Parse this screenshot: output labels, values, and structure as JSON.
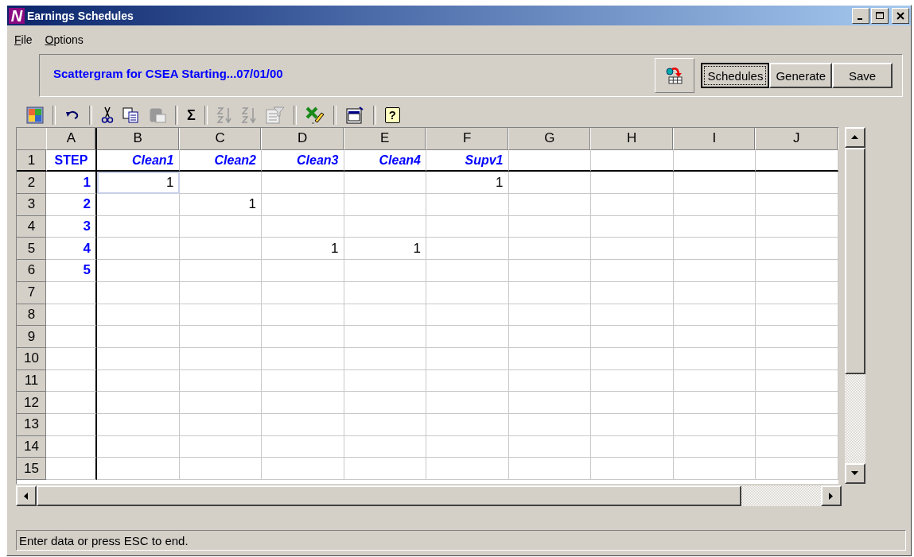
{
  "window": {
    "title": "Earnings Schedules",
    "logo": "N"
  },
  "menu": [
    {
      "label": "File"
    },
    {
      "label": "Options"
    }
  ],
  "header": {
    "title": "Scattergram for CSEA Starting...07/01/00",
    "buttons": [
      {
        "label": "Schedules",
        "selected": true
      },
      {
        "label": "Generate",
        "selected": false
      },
      {
        "label": "Save",
        "selected": false
      }
    ]
  },
  "toolbar": [
    {
      "kind": "puzzle",
      "disabled": false
    },
    {
      "kind": "separator"
    },
    {
      "kind": "undo",
      "disabled": false
    },
    {
      "kind": "separator"
    },
    {
      "kind": "cut",
      "disabled": false
    },
    {
      "kind": "copy",
      "disabled": false
    },
    {
      "kind": "paste",
      "disabled": true
    },
    {
      "kind": "separator"
    },
    {
      "kind": "sum",
      "label": "Σ",
      "disabled": false
    },
    {
      "kind": "separator"
    },
    {
      "kind": "sort-asc",
      "disabled": true
    },
    {
      "kind": "sort-desc",
      "disabled": true
    },
    {
      "kind": "filter",
      "disabled": true
    },
    {
      "kind": "separator"
    },
    {
      "kind": "export",
      "disabled": false
    },
    {
      "kind": "separator"
    },
    {
      "kind": "clipboard",
      "disabled": false
    },
    {
      "kind": "separator"
    },
    {
      "kind": "help",
      "label": "?",
      "disabled": false
    }
  ],
  "grid": {
    "columns": [
      "A",
      "B",
      "C",
      "D",
      "E",
      "F",
      "G",
      "H",
      "I",
      "J"
    ],
    "rows": [
      {
        "number": "1",
        "cells": [
          {
            "text": "STEP",
            "selected": false
          },
          {
            "text": "Clean1",
            "selected": false
          },
          {
            "text": "Clean2",
            "selected": false
          },
          {
            "text": "Clean3",
            "selected": false
          },
          {
            "text": "Clean4",
            "selected": false
          },
          {
            "text": "Supv1",
            "selected": false
          },
          null,
          null,
          null,
          null
        ]
      },
      {
        "number": "2",
        "cells": [
          {
            "text": "1",
            "selected": false
          },
          {
            "text": "1",
            "selected": true
          },
          null,
          null,
          null,
          {
            "text": "1",
            "selected": false
          },
          null,
          null,
          null,
          null
        ]
      },
      {
        "number": "3",
        "cells": [
          {
            "text": "2",
            "selected": false
          },
          null,
          {
            "text": "1",
            "selected": false
          },
          null,
          null,
          null,
          null,
          null,
          null,
          null
        ]
      },
      {
        "number": "4",
        "cells": [
          {
            "text": "3",
            "selected": false
          },
          null,
          null,
          null,
          null,
          null,
          null,
          null,
          null,
          null
        ]
      },
      {
        "number": "5",
        "cells": [
          {
            "text": "4",
            "selected": false
          },
          null,
          null,
          {
            "text": "1",
            "selected": false
          },
          {
            "text": "1",
            "selected": false
          },
          null,
          null,
          null,
          null,
          null
        ]
      },
      {
        "number": "6",
        "cells": [
          {
            "text": "5",
            "selected": false
          },
          null,
          null,
          null,
          null,
          null,
          null,
          null,
          null,
          null
        ]
      },
      {
        "number": "7",
        "cells": [
          null,
          null,
          null,
          null,
          null,
          null,
          null,
          null,
          null,
          null
        ]
      },
      {
        "number": "8",
        "cells": [
          null,
          null,
          null,
          null,
          null,
          null,
          null,
          null,
          null,
          null
        ]
      },
      {
        "number": "9",
        "cells": [
          null,
          null,
          null,
          null,
          null,
          null,
          null,
          null,
          null,
          null
        ]
      },
      {
        "number": "10",
        "cells": [
          null,
          null,
          null,
          null,
          null,
          null,
          null,
          null,
          null,
          null
        ]
      },
      {
        "number": "11",
        "cells": [
          null,
          null,
          null,
          null,
          null,
          null,
          null,
          null,
          null,
          null
        ]
      },
      {
        "number": "12",
        "cells": [
          null,
          null,
          null,
          null,
          null,
          null,
          null,
          null,
          null,
          null
        ]
      },
      {
        "number": "13",
        "cells": [
          null,
          null,
          null,
          null,
          null,
          null,
          null,
          null,
          null,
          null
        ]
      },
      {
        "number": "14",
        "cells": [
          null,
          null,
          null,
          null,
          null,
          null,
          null,
          null,
          null,
          null
        ]
      },
      {
        "number": "15",
        "cells": [
          null,
          null,
          null,
          null,
          null,
          null,
          null,
          null,
          null,
          null
        ]
      }
    ]
  },
  "status_bar": "Enter data or press ESC to end."
}
